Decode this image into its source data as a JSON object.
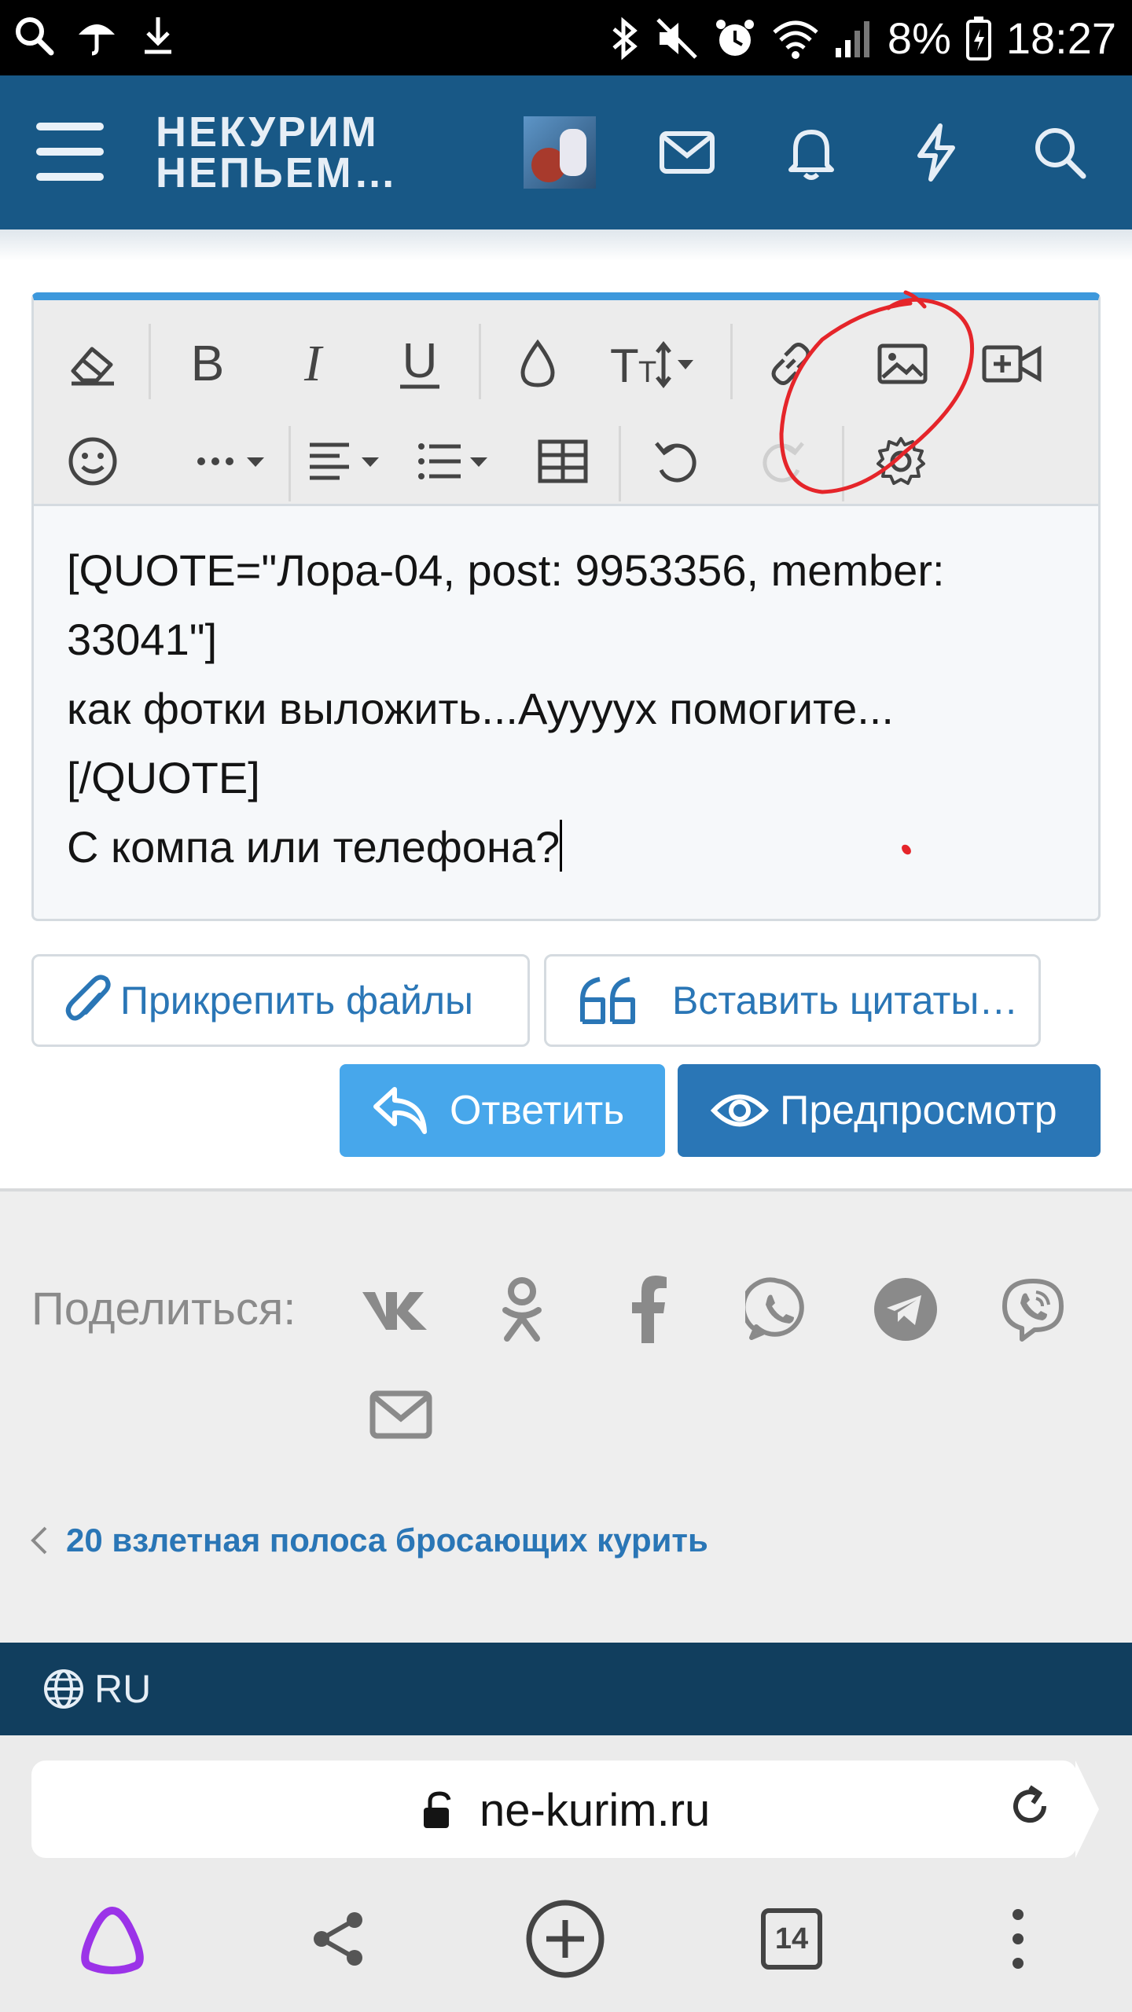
{
  "status_bar": {
    "battery": "8%",
    "time": "18:27",
    "icons": [
      "search-icon",
      "umbrella-icon",
      "download-icon",
      "bluetooth-icon",
      "mute-icon",
      "alarm-icon",
      "wifi-icon",
      "signal-icon",
      "battery-icon"
    ]
  },
  "header": {
    "logo_line1": "НЕКУРИМ",
    "logo_line2": "НЕПЬЕМ…",
    "icons": [
      "menu-icon",
      "avatar",
      "mail-icon",
      "bell-icon",
      "bolt-icon",
      "search-icon"
    ]
  },
  "editor": {
    "toolbar_row1": [
      "eraser-icon",
      "bold-icon",
      "italic-icon",
      "underline-icon",
      "color-drop-icon",
      "text-size-icon",
      "link-icon",
      "image-icon",
      "video-icon"
    ],
    "toolbar_row2": [
      "smile-icon",
      "more-icon",
      "align-icon",
      "list-icon",
      "table-icon",
      "undo-icon",
      "redo-icon",
      "gear-icon"
    ],
    "lines": [
      "[QUOTE=\"Лора-04, post: 9953356, member:",
      "33041\"]",
      "как фотки выложить...Ауууух помогите...",
      "[/QUOTE]",
      "С компа или телефона?"
    ]
  },
  "actions": {
    "attach_label": "Прикрепить файлы",
    "insert_quotes_label": "Вставить цитаты…",
    "reply_label": "Ответить",
    "preview_label": "Предпросмотр"
  },
  "share": {
    "label": "Поделиться:",
    "icons": [
      "vk-icon",
      "odnoklassniki-icon",
      "facebook-icon",
      "whatsapp-icon",
      "telegram-icon",
      "viber-icon",
      "email-icon"
    ]
  },
  "breadcrumb": {
    "back_label": "20 взлетная полоса бросающих курить"
  },
  "footer": {
    "language": "RU"
  },
  "browser": {
    "url": "ne-kurim.ru",
    "tab_count": "14"
  },
  "colors": {
    "header_bg": "#185886",
    "accent": "#3d98dc",
    "primary_button": "#2a76b6",
    "link": "#2a76b6",
    "annotation": "#e5252a",
    "footer_bg": "#113e5e"
  }
}
